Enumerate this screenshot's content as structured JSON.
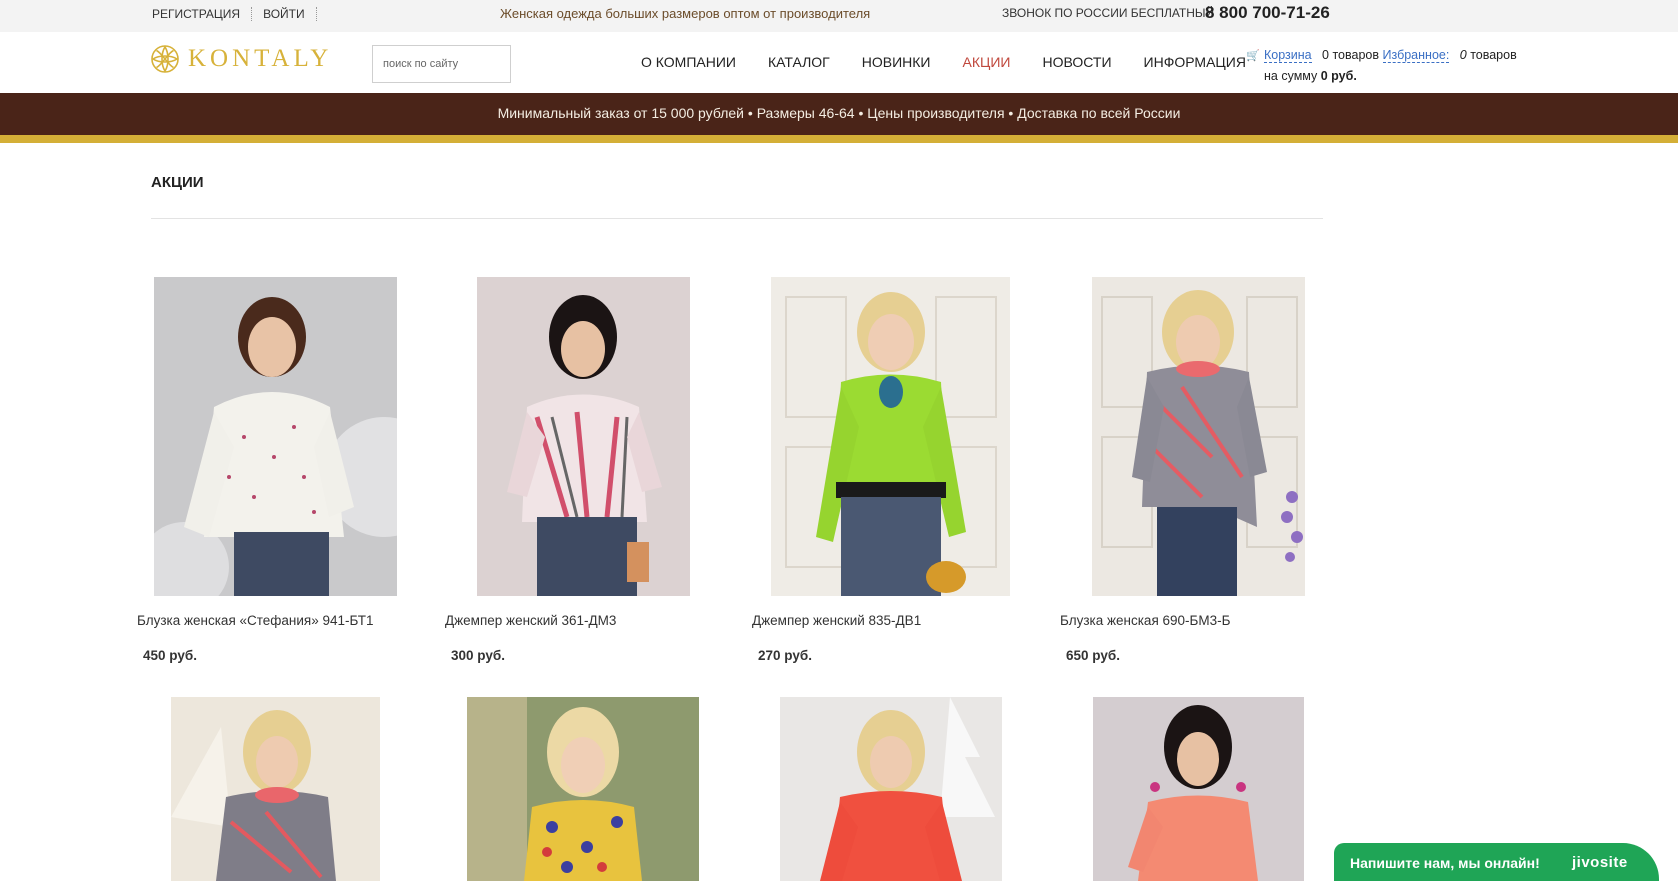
{
  "topbar": {
    "register": "Регистрация",
    "login": "Войти",
    "tagline": "Женская одежда больших размеров оптом от производителя",
    "call_label": "Звонок по России бесплатный",
    "phone": "8 800 700-71-26"
  },
  "header": {
    "brand": "KONTALY",
    "search_placeholder": "поиск по сайту",
    "nav": [
      {
        "label": "О компании"
      },
      {
        "label": "Каталог"
      },
      {
        "label": "Новинки"
      },
      {
        "label": "Акции"
      },
      {
        "label": "Новости"
      },
      {
        "label": "Информация"
      }
    ],
    "active_nav": "Акции",
    "cart": {
      "cart_link": "Корзина",
      "cart_count": "0 товаров",
      "favorites_link": "Избранное:",
      "favorites_num": "0",
      "favorites_suffix": "товаров",
      "sum_prefix": "на сумму",
      "sum_value": "0 руб."
    }
  },
  "strip": {
    "text": "Минимальный заказ от 15 000 рублей • Размеры 46-64 • Цены производителя • Доставка по всей России"
  },
  "main": {
    "title": "Акции",
    "products": [
      {
        "name": "Блузка женская «Стефания» 941-БТ1",
        "price": "450 руб."
      },
      {
        "name": "Джемпер женский 361-ДМ3",
        "price": "300 руб."
      },
      {
        "name": "Джемпер женский 835-ДВ1",
        "price": "270 руб."
      },
      {
        "name": "Блузка женская 690-БМ3-Б",
        "price": "650 руб."
      },
      {
        "name": "",
        "price": ""
      },
      {
        "name": "",
        "price": ""
      },
      {
        "name": "",
        "price": ""
      },
      {
        "name": "",
        "price": ""
      }
    ]
  },
  "chat": {
    "message": "Напишите нам, мы онлайн!",
    "brand": "jivosite"
  },
  "colors": {
    "accent": "#c0483d",
    "brown": "#4a2418",
    "gold": "#d4af37",
    "link": "#3a6fc4",
    "chat": "#1fa556"
  }
}
